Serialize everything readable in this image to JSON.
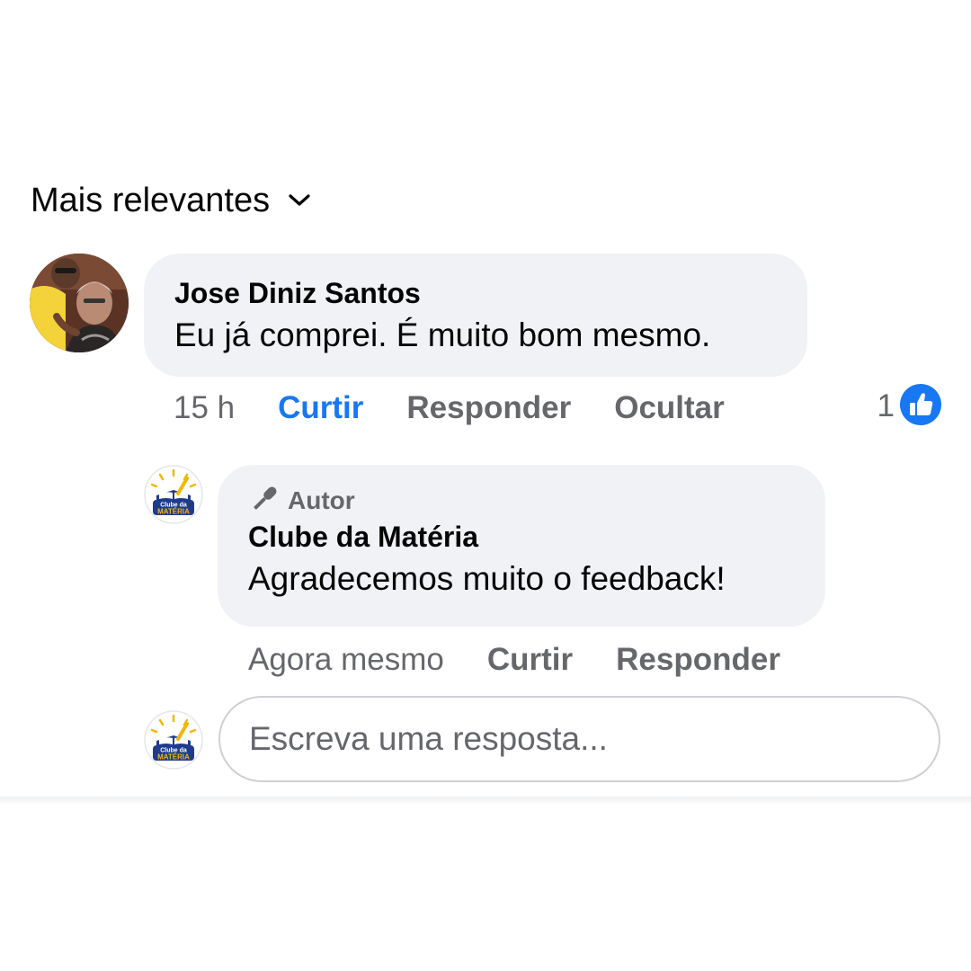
{
  "sort": {
    "label": "Mais relevantes"
  },
  "comment": {
    "author": "Jose Diniz Santos",
    "text": "Eu já comprei. É muito bom mesmo.",
    "time": "15 h",
    "actions": {
      "like": "Curtir",
      "reply": "Responder",
      "hide": "Ocultar"
    },
    "like_state": "liked",
    "reaction_count": "1",
    "reaction_icon": "thumbs-up-icon"
  },
  "reply": {
    "badge": "Autor",
    "badge_icon": "microphone-icon",
    "author": "Clube da Matéria",
    "text": "Agradecemos muito o feedback!",
    "time": "Agora mesmo",
    "actions": {
      "like": "Curtir",
      "reply": "Responder"
    }
  },
  "page_logo": {
    "line1": "Clube da",
    "line2": "MATÉRIA"
  },
  "reply_box": {
    "placeholder": "Escreva uma resposta..."
  },
  "colors": {
    "accent": "#1877f2",
    "bubble": "#f0f2f5",
    "muted_text": "#65676b",
    "logo_navy": "#1f3b8c",
    "logo_yellow": "#f2b705"
  }
}
